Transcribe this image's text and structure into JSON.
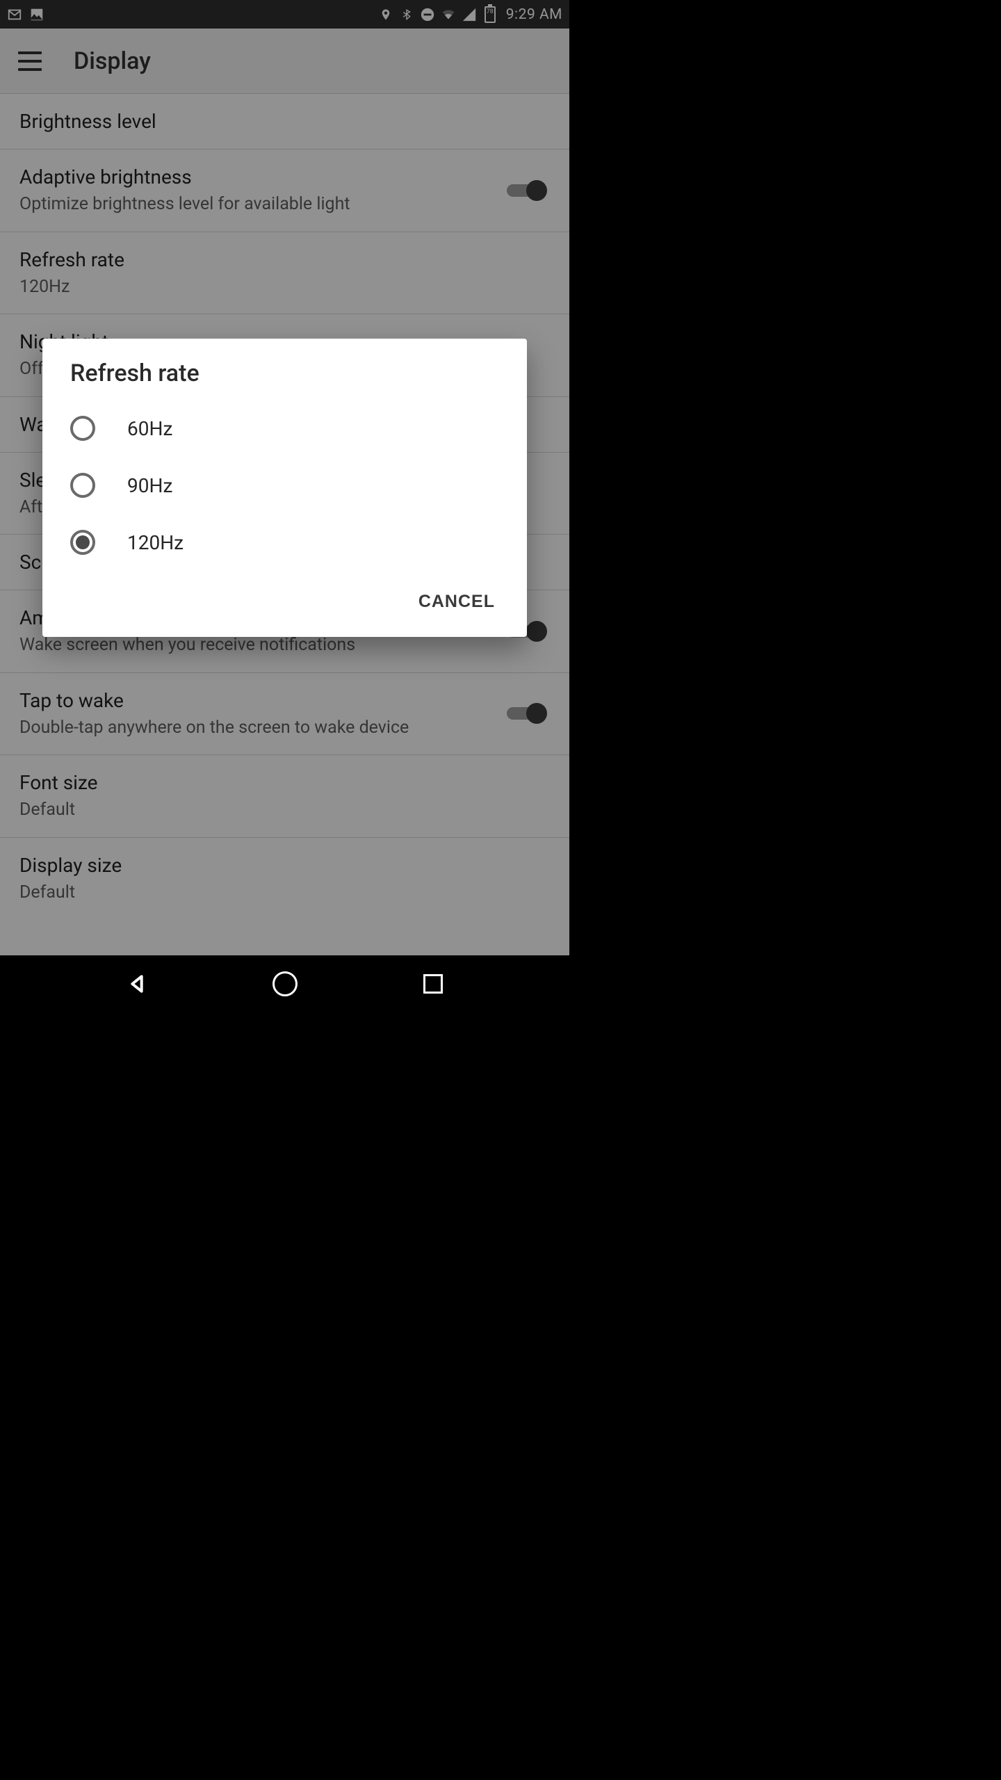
{
  "status": {
    "battery_pct": "78",
    "time": "9:29 AM"
  },
  "appbar": {
    "title": "Display"
  },
  "items": {
    "brightness": {
      "title": "Brightness level"
    },
    "adaptive": {
      "title": "Adaptive brightness",
      "sub": "Optimize brightness level for available light"
    },
    "refresh": {
      "title": "Refresh rate",
      "sub": "120Hz"
    },
    "nightlight": {
      "title": "Night light",
      "sub": "Off"
    },
    "wake": {
      "title": "Wake"
    },
    "sleep": {
      "title": "Sleep",
      "sub": "After"
    },
    "screensaver": {
      "title": "Screensaver"
    },
    "ambient": {
      "title": "Ambient display",
      "sub": "Wake screen when you receive notifications"
    },
    "tap": {
      "title": "Tap to wake",
      "sub": "Double-tap anywhere on the screen to wake device"
    },
    "font": {
      "title": "Font size",
      "sub": "Default"
    },
    "display": {
      "title": "Display size",
      "sub": "Default"
    }
  },
  "dialog": {
    "title": "Refresh rate",
    "opt60": "60Hz",
    "opt90": "90Hz",
    "opt120": "120Hz",
    "selected": "120Hz",
    "cancel": "CANCEL"
  }
}
